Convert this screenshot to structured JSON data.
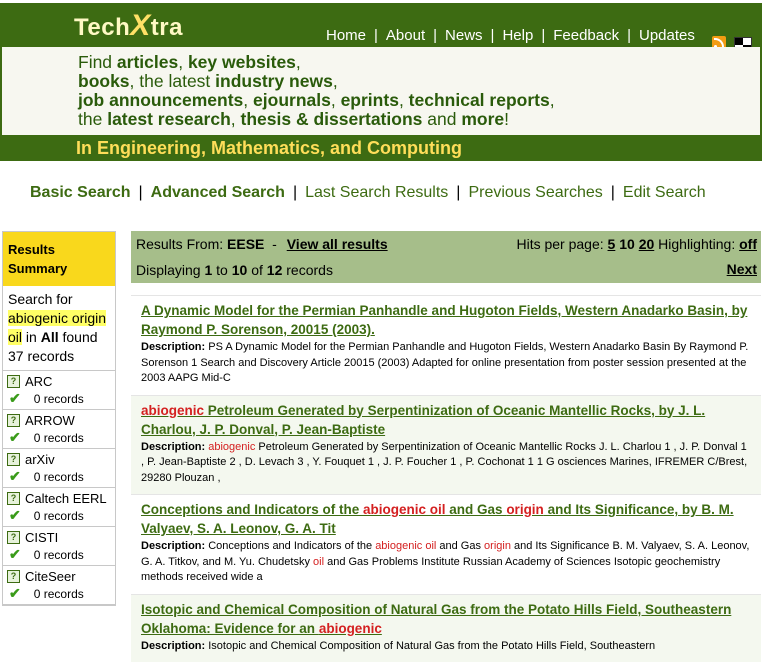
{
  "header": {
    "logo_part1": "Tech",
    "logo_x": "X",
    "logo_part2": "tra",
    "nav": [
      "Home",
      "About",
      "News",
      "Help",
      "Feedback",
      "Updates"
    ],
    "tagline_lines": [
      [
        "Find ",
        "articles",
        ", ",
        "key websites",
        ","
      ],
      [
        "books",
        ", the latest ",
        "industry news",
        ","
      ],
      [
        "job announcements",
        ", ",
        "ejournals",
        ", ",
        "eprints",
        ", ",
        "technical reports",
        ","
      ],
      [
        "the ",
        "latest research",
        ", ",
        "thesis & dissertations",
        " and ",
        "more",
        "!"
      ]
    ],
    "subtitle": "In Engineering, Mathematics, and Computing"
  },
  "search_nav": [
    "Basic Search",
    "Advanced Search",
    "Last Search Results",
    "Previous Searches",
    "Edit Search"
  ],
  "sidebar": {
    "title": "Results Summary",
    "summary_prefix": "Search for",
    "query": "abiogenic origin oil",
    "summary_in": "in",
    "summary_scope": "All",
    "summary_found": "found",
    "summary_count": "37 records",
    "sources": [
      {
        "name": "ARC",
        "count": "0 records"
      },
      {
        "name": "ARROW",
        "count": "0 records"
      },
      {
        "name": "arXiv",
        "count": "0 records"
      },
      {
        "name": "Caltech EERL",
        "count": "0 records"
      },
      {
        "name": "CISTI",
        "count": "0 records"
      },
      {
        "name": "CiteSeer",
        "count": "0 records"
      }
    ]
  },
  "results_header": {
    "from_label": "Results From:",
    "from_value": "EESE",
    "dash": "-",
    "view_all": "View all results",
    "hits_label": "Hits per page:",
    "hits_options": [
      "5",
      "10",
      "20"
    ],
    "highlight_label": "Highlighting:",
    "highlight_value": "off",
    "displaying": "Displaying",
    "from": "1",
    "to_word": "to",
    "to": "10",
    "of_word": "of",
    "total": "12",
    "records_word": "records",
    "next": "Next"
  },
  "results": [
    {
      "title": [
        {
          "t": "A Dynamic Model for the Permian Panhandle and Hugoton Fields, Western Anadarko Basin, by Raymond P. Sorenson, 20015 (2003).",
          "h": false
        }
      ],
      "desc": [
        {
          "t": "PS A Dynamic Model for the Permian Panhandle and Hugoton Fields, Western Anadarko Basin By Raymond P. Sorenson 1 Search and Discovery Article 20015 (2003) Adapted for online presentation from poster session presented at the 2003 AAPG Mid-C",
          "h": false
        }
      ]
    },
    {
      "title": [
        {
          "t": "abiogenic",
          "h": true
        },
        {
          "t": " Petroleum Generated by Serpentinization of Oceanic Mantellic Rocks, by J. L. Charlou, J. P. Donval, P. Jean-Baptiste",
          "h": false
        }
      ],
      "desc": [
        {
          "t": "abiogenic",
          "h": true
        },
        {
          "t": " Petroleum Generated by Serpentinization of Oceanic Mantellic Rocks J. L. Charlou 1 , J. P. Donval 1 , P. Jean-Baptiste 2 , D. Levach 3 , Y. Fouquet 1 , J. P. Foucher 1 , P. Cochonat 1 1 G osciences Marines, IFREMER C/Brest, 29280 Plouzan ,",
          "h": false
        }
      ]
    },
    {
      "title": [
        {
          "t": "Conceptions and Indicators of the ",
          "h": false
        },
        {
          "t": "abiogenic oil",
          "h": true
        },
        {
          "t": " and Gas ",
          "h": false
        },
        {
          "t": "origin",
          "h": true
        },
        {
          "t": " and Its Significance, by B. M. Valyaev, S. A. Leonov, G. A. Tit",
          "h": false
        }
      ],
      "desc": [
        {
          "t": "Conceptions and Indicators of the ",
          "h": false
        },
        {
          "t": "abiogenic oil",
          "h": true
        },
        {
          "t": " and Gas ",
          "h": false
        },
        {
          "t": "origin",
          "h": true
        },
        {
          "t": " and Its Significance B. M. Valyaev, S. A. Leonov, G. A. Titkov, and M. Yu. Chudetsky ",
          "h": false
        },
        {
          "t": "oil",
          "h": true
        },
        {
          "t": " and Gas Problems Institute Russian Academy of Sciences Isotopic geochemistry methods received wide a",
          "h": false
        }
      ]
    },
    {
      "title": [
        {
          "t": "Isotopic and Chemical Composition of Natural Gas from the Potato Hills Field, Southeastern Oklahoma: Evidence for an ",
          "h": false
        },
        {
          "t": "abiogenic",
          "h": true
        }
      ],
      "desc": [
        {
          "t": "Isotopic and Chemical Composition of Natural Gas from the Potato Hills Field, Southeastern",
          "h": false
        }
      ]
    }
  ],
  "desc_label": "Description:",
  "colors": {
    "brand_green": "#3d6b12",
    "header_yellow": "#ffde59",
    "highlight_red": "#d42020",
    "summary_yellow": "#f9d81c",
    "results_bar": "#a6be8a"
  }
}
